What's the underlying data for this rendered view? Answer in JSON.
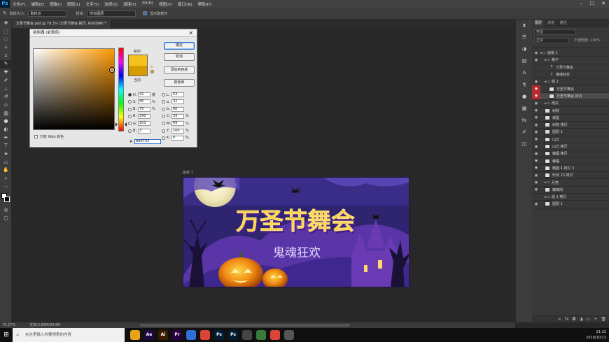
{
  "menubar": {
    "logo": "Ps",
    "items": [
      "文件(F)",
      "编辑(E)",
      "图像(I)",
      "图层(L)",
      "文字(Y)",
      "选择(S)",
      "滤镜(T)",
      "3D(D)",
      "视图(V)",
      "窗口(W)",
      "帮助(H)"
    ]
  },
  "optbar": {
    "sample_size_label": "取样大小:",
    "sample_size_value": "取样点",
    "sample_label": "样本:",
    "sample_value": "所有图层",
    "show_ring_label": "显示取样环"
  },
  "doc_tab": "万圣节舞会.psd @ 79.3% (万圣节舞会 拷贝, RGB/8#) *",
  "status": {
    "zoom": "79.27%",
    "doc": "文档:3.66M/99.6M"
  },
  "artboard_label": "画板 1",
  "artwork": {
    "title": "万圣节舞会",
    "subtitle": "鬼魂狂欢",
    "bg_color": "#3b2a7a",
    "title_color": "#f6c624"
  },
  "color_picker": {
    "title": "拾色器 (前景色)",
    "new_label": "新的",
    "current_label": "当前",
    "buttons": {
      "ok": "确定",
      "cancel": "取消",
      "add_swatch": "添加到色板",
      "libraries": "颜色库"
    },
    "web_only": "只有 Web 颜色",
    "new_color": "#f4c21a",
    "current_color": "#d79c00",
    "fields_left": [
      {
        "name": "H:",
        "value": "32",
        "unit": "度",
        "on": true
      },
      {
        "name": "S:",
        "value": "96",
        "unit": "%",
        "on": false
      },
      {
        "name": "B:",
        "value": "75",
        "unit": "%",
        "on": false
      },
      {
        "name": "R:",
        "value": "190",
        "unit": "",
        "on": false
      },
      {
        "name": "G:",
        "value": "103",
        "unit": "",
        "on": false
      },
      {
        "name": "B:",
        "value": "3",
        "unit": "",
        "on": false
      }
    ],
    "fields_right": [
      {
        "name": "L:",
        "value": "53",
        "unit": "",
        "on": false
      },
      {
        "name": "a:",
        "value": "32",
        "unit": "",
        "on": false
      },
      {
        "name": "b:",
        "value": "60",
        "unit": "",
        "on": false
      },
      {
        "name": "C:",
        "value": "33",
        "unit": "%",
        "on": false
      },
      {
        "name": "M:",
        "value": "69",
        "unit": "%",
        "on": false
      },
      {
        "name": "Y:",
        "value": "100",
        "unit": "%",
        "on": false
      },
      {
        "name": "K:",
        "value": "0",
        "unit": "%",
        "on": false
      }
    ],
    "hex_label": "#",
    "hex_value": "be6703"
  },
  "layers_panel": {
    "tabs": [
      "图层",
      "通道",
      "路径"
    ],
    "search_placeholder": "类型",
    "blend_mode": "正常",
    "opacity_label": "不透明度: 100%",
    "layers": [
      {
        "name": "画板 1",
        "type": "group",
        "indent": 0,
        "eye": "normal",
        "sel": false
      },
      {
        "name": "帽子",
        "type": "group",
        "indent": 1,
        "eye": "normal",
        "sel": false
      },
      {
        "name": "万圣节舞会",
        "type": "text",
        "indent": 2,
        "eye": "none",
        "sel": false
      },
      {
        "name": "鬼魂狂欢",
        "type": "text",
        "indent": 2,
        "eye": "none",
        "sel": false
      },
      {
        "name": "组 1",
        "type": "group",
        "indent": 1,
        "eye": "normal",
        "sel": false
      },
      {
        "name": "万圣节舞会",
        "type": "layer",
        "indent": 2,
        "eye": "red",
        "sel": false
      },
      {
        "name": "万圣节舞会 拷贝",
        "type": "layer",
        "indent": 2,
        "eye": "red",
        "sel": true
      },
      {
        "name": "南瓜",
        "type": "group",
        "indent": 1,
        "eye": "normal",
        "sel": false
      },
      {
        "name": "树枝",
        "type": "layer",
        "indent": 1,
        "eye": "normal",
        "sel": false
      },
      {
        "name": "城堡",
        "type": "layer",
        "indent": 1,
        "eye": "normal",
        "sel": false
      },
      {
        "name": "树枝 拷贝",
        "type": "layer",
        "indent": 1,
        "eye": "normal",
        "sel": false
      },
      {
        "name": "图层 2",
        "type": "layer",
        "indent": 1,
        "eye": "normal",
        "sel": false
      },
      {
        "name": "山丘",
        "type": "layer",
        "indent": 1,
        "eye": "normal",
        "sel": false
      },
      {
        "name": "山丘 拷贝",
        "type": "layer",
        "indent": 1,
        "eye": "normal",
        "sel": false
      },
      {
        "name": "蝙蝠 拷贝",
        "type": "layer",
        "indent": 1,
        "eye": "normal",
        "sel": false
      },
      {
        "name": "蝙蝠",
        "type": "layer",
        "indent": 1,
        "eye": "normal",
        "sel": false
      },
      {
        "name": "椭圆 4 拷贝 3",
        "type": "layer",
        "indent": 1,
        "eye": "normal",
        "sel": false
      },
      {
        "name": "形状 23 拷贝",
        "type": "layer",
        "indent": 1,
        "eye": "normal",
        "sel": false
      },
      {
        "name": "月亮",
        "type": "group",
        "indent": 1,
        "eye": "normal",
        "sel": false
      },
      {
        "name": "蜘蛛网",
        "type": "layer",
        "indent": 1,
        "eye": "normal",
        "sel": false
      },
      {
        "name": "组 1 拷贝",
        "type": "group",
        "indent": 1,
        "eye": "none",
        "sel": false
      },
      {
        "name": "图层 1",
        "type": "layer",
        "indent": 1,
        "eye": "normal",
        "sel": false
      }
    ]
  },
  "taskbar": {
    "search_placeholder": "在这里输入你要搜索的内容",
    "apps": [
      {
        "label": "",
        "color": "#e8a317"
      },
      {
        "label": "Ae",
        "color": "#1f0740"
      },
      {
        "label": "Ai",
        "color": "#3a1d00"
      },
      {
        "label": "Pr",
        "color": "#2a0043"
      },
      {
        "label": "",
        "color": "#2f6fd6"
      },
      {
        "label": "",
        "color": "#db4437"
      },
      {
        "label": "Ps",
        "color": "#001d34"
      },
      {
        "label": "Ps",
        "color": "#001d34"
      },
      {
        "label": "",
        "color": "#444444"
      },
      {
        "label": "",
        "color": "#3b7a3b"
      },
      {
        "label": "",
        "color": "#db4437"
      },
      {
        "label": "",
        "color": "#555555"
      }
    ],
    "time": "21:32",
    "date": "2019/10/13"
  }
}
